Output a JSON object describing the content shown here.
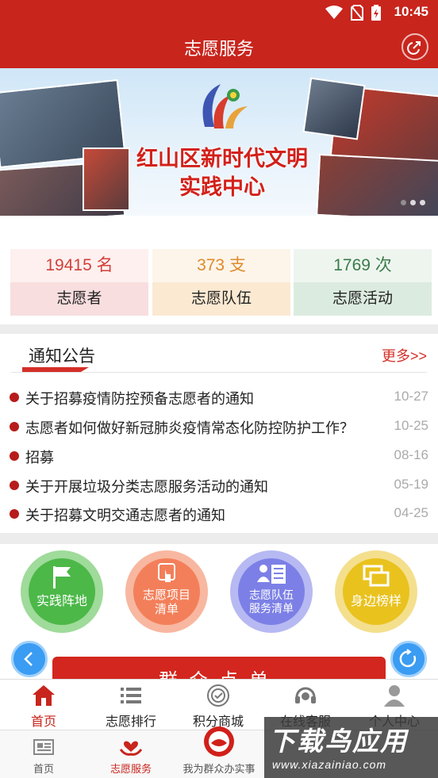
{
  "status_bar": {
    "time": "10:45",
    "icons": [
      "wifi-icon",
      "no-sim-icon",
      "battery-charging-icon"
    ]
  },
  "header": {
    "title": "志愿服务",
    "icon": "share-icon"
  },
  "banner": {
    "title_line1": "红山区新时代文明",
    "title_line2": "实践中心"
  },
  "stats": [
    {
      "value": "19415 名",
      "label": "志愿者",
      "color": "#d2403a"
    },
    {
      "value": "373 支",
      "label": "志愿队伍",
      "color": "#e08a2c"
    },
    {
      "value": "1769 次",
      "label": "志愿活动",
      "color": "#3a7b4a"
    }
  ],
  "notices": {
    "title": "通知公告",
    "more": "更多>>",
    "items": [
      {
        "title": "关于招募疫情防控预备志愿者的通知",
        "date": "10-27"
      },
      {
        "title": "志愿者如何做好新冠肺炎疫情常态化防控防护工作？",
        "date": "10-25"
      },
      {
        "title": "招募",
        "date": "08-16"
      },
      {
        "title": "关于开展垃圾分类志愿服务活动的通知",
        "date": "05-19"
      },
      {
        "title": "关于招募文明交通志愿者的通知",
        "date": "04-25"
      }
    ]
  },
  "services": [
    {
      "line1": "实践阵地",
      "line2": "",
      "icon": "flag-icon"
    },
    {
      "line1": "志愿项目",
      "line2": "清单",
      "icon": "touch-icon"
    },
    {
      "line1": "志愿队伍",
      "line2": "服务清单",
      "icon": "team-list-icon"
    },
    {
      "line1": "身边榜样",
      "line2": "",
      "icon": "windows-icon"
    }
  ],
  "red_button": "群众点单",
  "inner_tabs": [
    {
      "label": "首页",
      "icon": "home-icon",
      "active": true
    },
    {
      "label": "志愿排行",
      "icon": "ranking-list-icon",
      "active": false
    },
    {
      "label": "积分商城",
      "icon": "points-mall-icon",
      "active": false
    },
    {
      "label": "在线客服",
      "icon": "headset-icon",
      "active": false
    },
    {
      "label": "个人中心",
      "icon": "person-icon",
      "active": false
    }
  ],
  "bottom_nav": [
    {
      "label": "首页",
      "icon": "newspaper-icon",
      "active": false
    },
    {
      "label": "志愿服务",
      "icon": "heart-hands-icon",
      "active": true
    },
    {
      "label": "我为群众办实事",
      "icon": "badge-logo-icon",
      "active": false
    }
  ],
  "watermark": {
    "big": "下载鸟应用",
    "small": "www.xiazainiao.com"
  },
  "colors": {
    "primary_red": "#c8251d",
    "fab_blue": "#3a9cf2"
  }
}
